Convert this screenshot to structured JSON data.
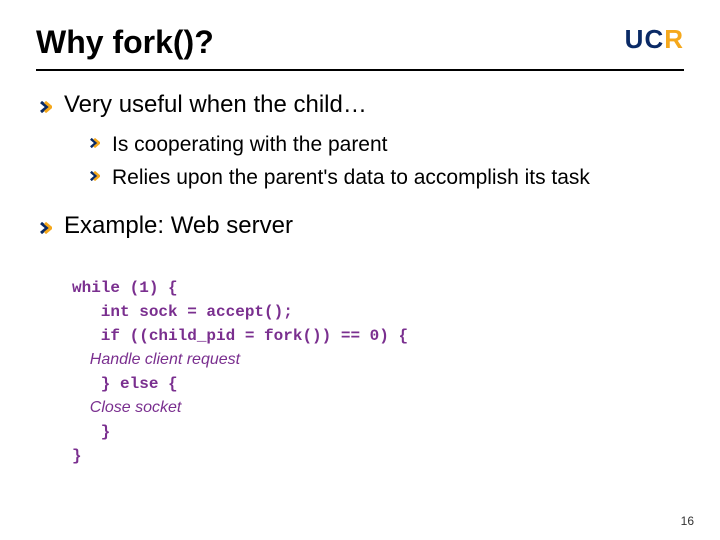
{
  "title": "Why fork()?",
  "logo": {
    "u": "U",
    "c": "C",
    "r": "R"
  },
  "bullets": {
    "b1": "Very useful when the child…",
    "b1_1": "Is cooperating with the parent",
    "b1_2": "Relies upon the parent's data to accomplish its task",
    "b2": "Example: Web server"
  },
  "code": {
    "l1": "while (1) {",
    "l2": "   int sock = accept();",
    "l3": "   if ((child_pid = fork()) == 0) {",
    "l4": "    Handle client request",
    "l5": "   } else {",
    "l6": "    Close socket",
    "l7": "   }",
    "l8": "}"
  },
  "page_number": "16"
}
